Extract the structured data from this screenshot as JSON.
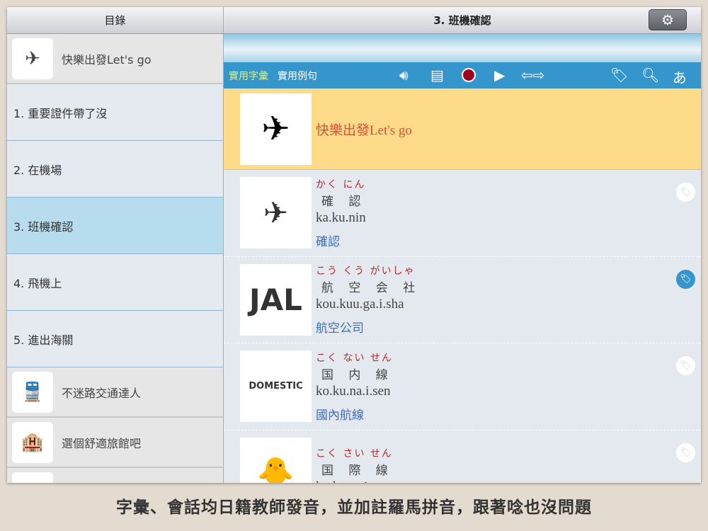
{
  "left_header": "目錄",
  "right_header": "3. 班機確認",
  "topics": [
    {
      "label": "快樂出發Let's go",
      "icon": "✈"
    },
    {
      "label": "不迷路交通達人",
      "icon": "🚆"
    },
    {
      "label": "選個舒適旅館吧",
      "icon": "🏨"
    }
  ],
  "chapters": [
    "1. 重要證件帶了沒",
    "2. 在機場",
    "3. 班機確認",
    "4. 飛機上",
    "5. 進出海關"
  ],
  "toolbar": {
    "tab_vocab": "實用字彙",
    "tab_sentences": "實用例句",
    "kana_button": "あ"
  },
  "lesson_title": "快樂出發Let's go",
  "words": [
    {
      "kana": "かく にん",
      "kanji": "確 認",
      "romaji": "ka.ku.nin",
      "chinese": "確認",
      "image": "✈",
      "tagged": false
    },
    {
      "kana": "こう くう がいしゃ",
      "kanji": "航 空 会 社",
      "romaji": "kou.kuu.ga.i.sha",
      "chinese": "航空公司",
      "image": "JAL",
      "tagged": true
    },
    {
      "kana": "こく ない せん",
      "kanji": "国 内 線",
      "romaji": "ko.ku.na.i.sen",
      "chinese": "國內航線",
      "image": "DOMESTIC",
      "tagged": false
    },
    {
      "kana": "こく さい せん",
      "kanji": "国 際 線",
      "romaji": "ko.ku.sa.i.sen",
      "chinese": "",
      "image": "🐥",
      "tagged": false
    }
  ],
  "caption": "字彙、會話均日籍教師發音，並加註羅馬拼音，跟著唸也沒問題"
}
